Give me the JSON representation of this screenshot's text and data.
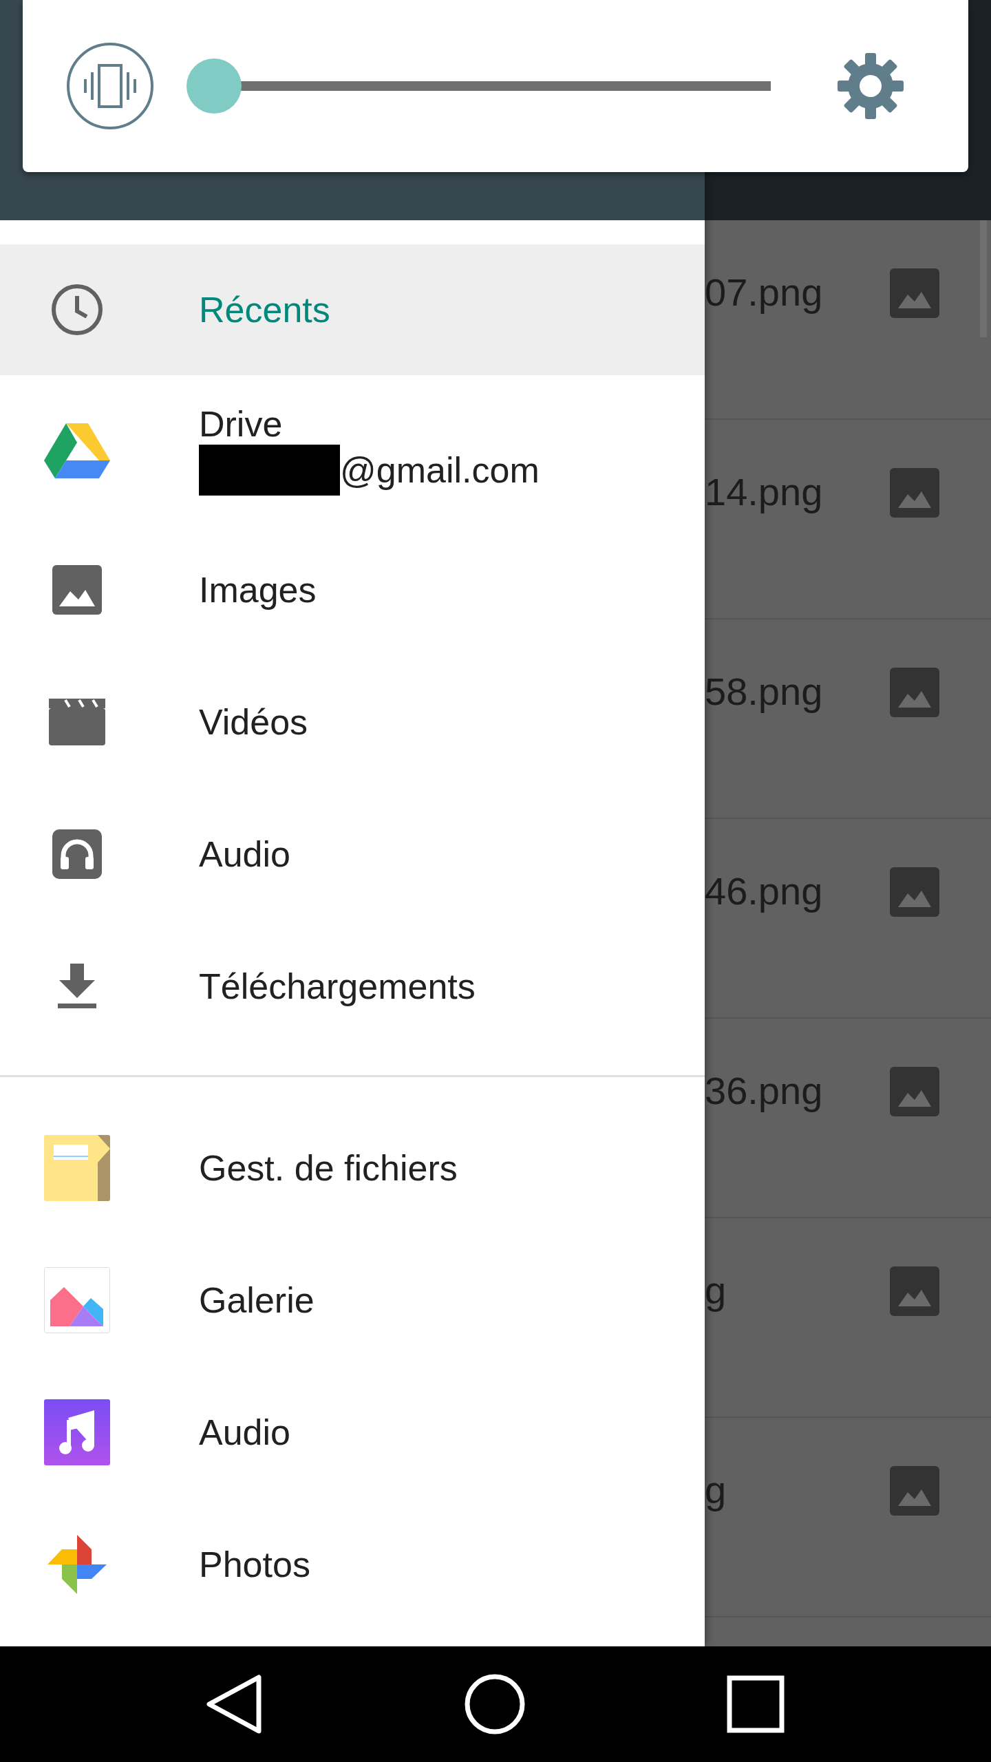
{
  "volume_panel": {
    "slider": {
      "level": 0
    }
  },
  "drawer": {
    "roots": [
      {
        "kind": "recent",
        "label": "Récents",
        "selected": true
      },
      {
        "kind": "drive",
        "label": "Drive",
        "subtitle": "@gmail.com",
        "selected": false
      },
      {
        "kind": "images",
        "label": "Images",
        "selected": false
      },
      {
        "kind": "videos",
        "label": "Vidéos",
        "selected": false
      },
      {
        "kind": "audio",
        "label": "Audio",
        "selected": false
      },
      {
        "kind": "downloads",
        "label": "Téléchargements",
        "selected": false
      }
    ],
    "apps": [
      {
        "kind": "files",
        "label": "Gest. de fichiers"
      },
      {
        "kind": "gallery",
        "label": "Galerie"
      },
      {
        "kind": "music",
        "label": "Audio"
      },
      {
        "kind": "photos",
        "label": "Photos"
      }
    ]
  },
  "file_list": {
    "rows": [
      {
        "name": "07.png"
      },
      {
        "name": "14.png"
      },
      {
        "name": "58.png"
      },
      {
        "name": "46.png"
      },
      {
        "name": "36.png"
      },
      {
        "name": "g"
      },
      {
        "name": "g"
      }
    ]
  }
}
